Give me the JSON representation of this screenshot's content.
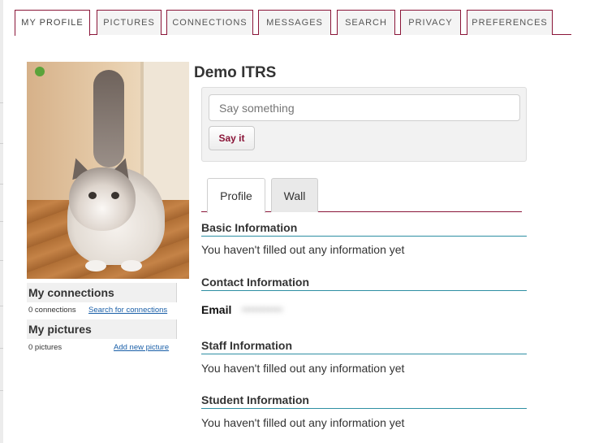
{
  "tabs": [
    {
      "label": "MY PROFILE",
      "active": true
    },
    {
      "label": "PICTURES",
      "active": false
    },
    {
      "label": "CONNECTIONS",
      "active": false
    },
    {
      "label": "MESSAGES",
      "active": false
    },
    {
      "label": "SEARCH",
      "active": false
    },
    {
      "label": "PRIVACY",
      "active": false
    },
    {
      "label": "PREFERENCES",
      "active": false
    }
  ],
  "sidebar": {
    "connections": {
      "title": "My connections",
      "count": "0 connections",
      "link": "Search for connections"
    },
    "pictures": {
      "title": "My pictures",
      "count": "0 pictures",
      "link": "Add new picture"
    }
  },
  "profile": {
    "name": "Demo ITRS",
    "status_placeholder": "Say something",
    "status_button": "Say it"
  },
  "subtabs": [
    {
      "label": "Profile",
      "active": true
    },
    {
      "label": "Wall",
      "active": false
    }
  ],
  "sections": {
    "basic": {
      "title": "Basic Information",
      "text": "You haven't filled out any information yet"
    },
    "contact": {
      "title": "Contact Information",
      "email_label": "Email",
      "email_value": "•••••••••••"
    },
    "staff": {
      "title": "Staff Information",
      "text": "You haven't filled out any information yet"
    },
    "student": {
      "title": "Student Information",
      "text": "You haven't filled out any information yet"
    }
  },
  "colors": {
    "accent": "#8a1538",
    "section_rule": "#2e8fa3",
    "link": "#1a5fa8"
  }
}
